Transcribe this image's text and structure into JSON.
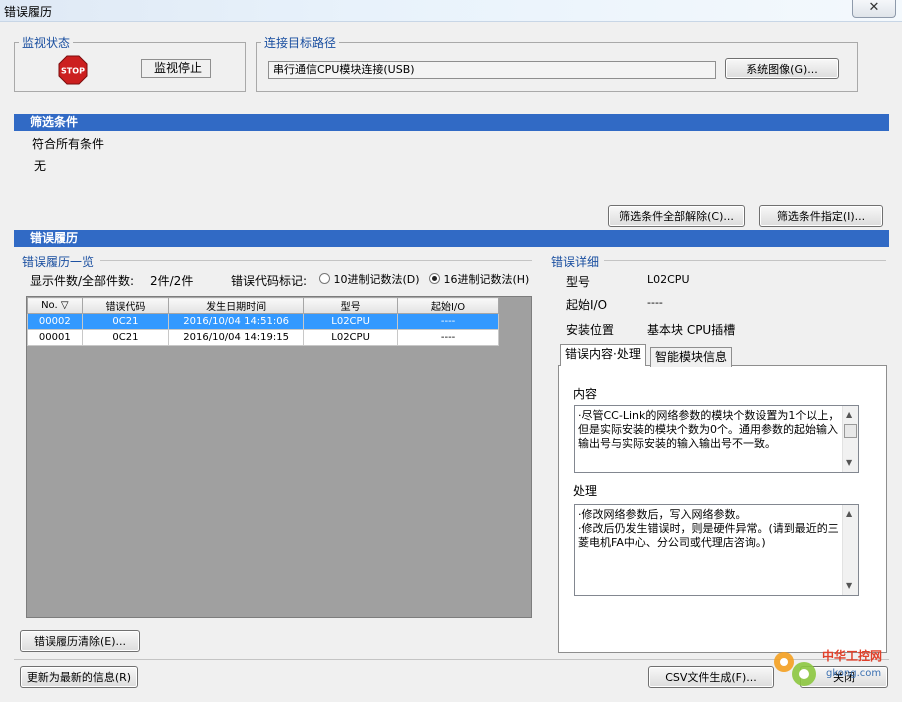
{
  "window": {
    "title": "错误履历",
    "close_glyph": "✕"
  },
  "monitor": {
    "legend": "监视状态",
    "stop_label": "STOP",
    "status": "监视停止"
  },
  "connection": {
    "legend": "连接目标路径",
    "path": "串行通信CPU模块连接(USB)",
    "system_image_btn": "系统图像(G)..."
  },
  "filter": {
    "header": "筛选条件",
    "line1": "符合所有条件",
    "line2": "无",
    "clear_btn": "筛选条件全部解除(C)...",
    "specify_btn": "筛选条件指定(I)..."
  },
  "history": {
    "header": "错误履历",
    "list_legend": "错误履历一览",
    "count_label": "显示件数/全部件数:",
    "count_value": "2件/2件",
    "code_notation_label": "错误代码标记:",
    "radio_dec": "10进制记数法(D)",
    "radio_hex": "16进制记数法(H)",
    "columns": [
      "No. ▽",
      "错误代码",
      "发生日期时间",
      "型号",
      "起始I/O"
    ],
    "rows": [
      [
        "00002",
        "0C21",
        "2016/10/04 14:51:06",
        "L02CPU",
        "----"
      ],
      [
        "00001",
        "0C21",
        "2016/10/04 14:19:15",
        "L02CPU",
        "----"
      ]
    ],
    "clear_btn": "错误履历清除(E)..."
  },
  "detail": {
    "legend": "错误详细",
    "model_label": "型号",
    "model_value": "L02CPU",
    "io_label": "起始I/O",
    "io_value": "----",
    "location_label": "安装位置",
    "location_value": "基本块 CPU插槽",
    "tab1": "错误内容·处理",
    "tab2": "智能模块信息",
    "content_label": "内容",
    "content_text": "·尽管CC-Link的网络参数的模块个数设置为1个以上，但是实际安装的模块个数为0个。通用参数的起始输入输出号与实际安装的输入输出号不一致。",
    "action_label": "处理",
    "action_text1": "·修改网络参数后，写入网络参数。",
    "action_text2": "·修改后仍发生错误时，则是硬件异常。(请到最近的三菱电机FA中心、分公司或代理店咨询。)"
  },
  "footer": {
    "refresh_btn": "更新为最新的信息(R)",
    "csv_btn": "CSV文件生成(F)...",
    "close_btn": "关闭"
  },
  "watermark": {
    "text1": "中华工控网",
    "text2": "gkong.com"
  },
  "colors": {
    "section_bar": "#316ac5",
    "legend_text": "#1a4fa0",
    "selected_row": "#3399ff",
    "stop_red": "#cc1f1f"
  }
}
